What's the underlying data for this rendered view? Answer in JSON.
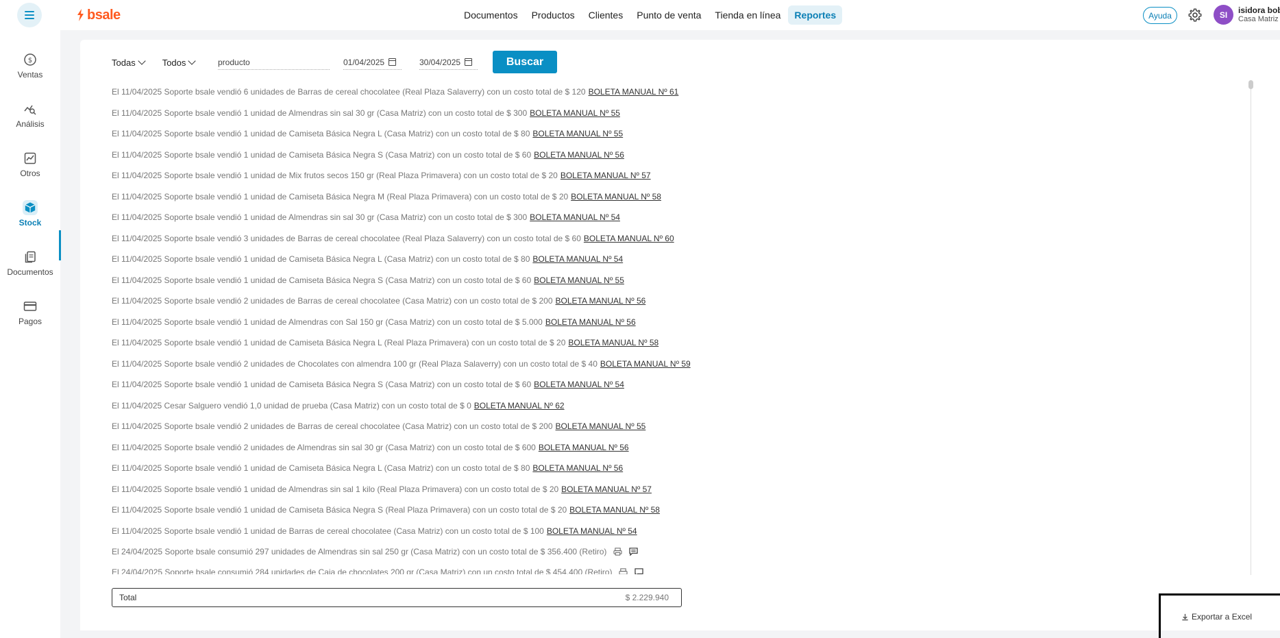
{
  "topbar": {
    "brand": "bsale",
    "nav": [
      "Documentos",
      "Productos",
      "Clientes",
      "Punto de venta",
      "Tienda en línea",
      "Reportes"
    ],
    "active_nav": "Reportes",
    "help_label": "Ayuda",
    "user_initials": "SI",
    "user_name": "isidora bob",
    "user_store": "Casa Matriz",
    "accent_color": "#0a8fc4",
    "brand_color": "#ff5a1f",
    "avatar_color": "#8e4ec6"
  },
  "sidebar": {
    "items": [
      {
        "label": "Ventas",
        "icon": "dollar-circle-icon"
      },
      {
        "label": "Análisis",
        "icon": "analytics-search-icon"
      },
      {
        "label": "Otros",
        "icon": "chart-trend-icon"
      },
      {
        "label": "Stock",
        "icon": "box-icon"
      },
      {
        "label": "Documentos",
        "icon": "documents-icon"
      },
      {
        "label": "Pagos",
        "icon": "credit-card-icon"
      }
    ],
    "active": "Stock"
  },
  "filters": {
    "filter1": "Todas",
    "filter2": "Todos",
    "search_value": "producto",
    "date_from": "01/04/2025",
    "date_to": "30/04/2025",
    "search_button": "Buscar"
  },
  "rows": [
    {
      "text": "El 11/04/2025 Soporte bsale vendió 6 unidades de Barras de cereal chocolatee (Real Plaza Salaverry) con un costo total de $ 120",
      "link": "BOLETA MANUAL Nº 61"
    },
    {
      "text": "El 11/04/2025 Soporte bsale vendió 1 unidad de Almendras sin sal 30 gr (Casa Matriz) con un costo total de $ 300",
      "link": "BOLETA MANUAL Nº 55"
    },
    {
      "text": "El 11/04/2025 Soporte bsale vendió 1 unidad de Camiseta Básica Negra L (Casa Matriz) con un costo total de $ 80",
      "link": "BOLETA MANUAL Nº 55"
    },
    {
      "text": "El 11/04/2025 Soporte bsale vendió 1 unidad de Camiseta Básica Negra S (Casa Matriz) con un costo total de $ 60",
      "link": "BOLETA MANUAL Nº 56"
    },
    {
      "text": "El 11/04/2025 Soporte bsale vendió 1 unidad de Mix frutos secos 150 gr (Real Plaza Primavera) con un costo total de $ 20",
      "link": "BOLETA MANUAL Nº 57"
    },
    {
      "text": "El 11/04/2025 Soporte bsale vendió 1 unidad de Camiseta Básica Negra M (Real Plaza Primavera) con un costo total de $ 20",
      "link": "BOLETA MANUAL Nº 58"
    },
    {
      "text": "El 11/04/2025 Soporte bsale vendió 1 unidad de Almendras sin sal 30 gr (Casa Matriz) con un costo total de $ 300",
      "link": "BOLETA MANUAL Nº 54"
    },
    {
      "text": "El 11/04/2025 Soporte bsale vendió 3 unidades de Barras de cereal chocolatee (Real Plaza Salaverry) con un costo total de $ 60",
      "link": "BOLETA MANUAL Nº 60"
    },
    {
      "text": "El 11/04/2025 Soporte bsale vendió 1 unidad de Camiseta Básica Negra L (Casa Matriz) con un costo total de $ 80",
      "link": "BOLETA MANUAL Nº 54"
    },
    {
      "text": "El 11/04/2025 Soporte bsale vendió 1 unidad de Camiseta Básica Negra S (Casa Matriz) con un costo total de $ 60",
      "link": "BOLETA MANUAL Nº 55"
    },
    {
      "text": "El 11/04/2025 Soporte bsale vendió 2 unidades de Barras de cereal chocolatee (Casa Matriz) con un costo total de $ 200",
      "link": "BOLETA MANUAL Nº 56"
    },
    {
      "text": "El 11/04/2025 Soporte bsale vendió 1 unidad de Almendras con Sal 150 gr (Casa Matriz) con un costo total de $ 5.000",
      "link": "BOLETA MANUAL Nº 56"
    },
    {
      "text": "El 11/04/2025 Soporte bsale vendió 1 unidad de Camiseta Básica Negra L (Real Plaza Primavera) con un costo total de $ 20",
      "link": "BOLETA MANUAL Nº 58"
    },
    {
      "text": "El 11/04/2025 Soporte bsale vendió 2 unidades de Chocolates con almendra 100 gr (Real Plaza Salaverry) con un costo total de $ 40",
      "link": "BOLETA MANUAL Nº 59"
    },
    {
      "text": "El 11/04/2025 Soporte bsale vendió 1 unidad de Camiseta Básica Negra S (Casa Matriz) con un costo total de $ 60",
      "link": "BOLETA MANUAL Nº 54"
    },
    {
      "text": "El 11/04/2025 Cesar Salguero vendió 1,0 unidad de prueba (Casa Matriz) con un costo total de $ 0",
      "link": "BOLETA MANUAL Nº 62"
    },
    {
      "text": "El 11/04/2025 Soporte bsale vendió 2 unidades de Barras de cereal chocolatee (Casa Matriz) con un costo total de $ 200",
      "link": "BOLETA MANUAL Nº 55"
    },
    {
      "text": "El 11/04/2025 Soporte bsale vendió 2 unidades de Almendras sin sal 30 gr (Casa Matriz) con un costo total de $ 600",
      "link": "BOLETA MANUAL Nº 56"
    },
    {
      "text": "El 11/04/2025 Soporte bsale vendió 1 unidad de Camiseta Básica Negra L (Casa Matriz) con un costo total de $ 80",
      "link": "BOLETA MANUAL Nº 56"
    },
    {
      "text": "El 11/04/2025 Soporte bsale vendió 1 unidad de Almendras sin sal 1 kilo (Real Plaza Primavera) con un costo total de $ 20",
      "link": "BOLETA MANUAL Nº 57"
    },
    {
      "text": "El 11/04/2025 Soporte bsale vendió 1 unidad de Camiseta Básica Negra S (Real Plaza Primavera) con un costo total de $ 20",
      "link": "BOLETA MANUAL Nº 58"
    },
    {
      "text": "El 11/04/2025 Soporte bsale vendió 1 unidad de Barras de cereal chocolatee (Casa Matriz) con un costo total de $ 100",
      "link": "BOLETA MANUAL Nº 54"
    },
    {
      "text": "El 24/04/2025 Soporte bsale consumió 297 unidades de Almendras sin sal 250 gr (Casa Matriz) con un costo total de $ 356.400 (Retiro)",
      "link": "",
      "icons": true
    },
    {
      "text": "El 24/04/2025 Soporte bsale consumió 284 unidades de Caja de chocolates 200 gr (Casa Matriz) con un costo total de $ 454.400 (Retiro)",
      "link": "",
      "icons": true
    }
  ],
  "total": {
    "label": "Total",
    "value": "$ 2.229.940"
  },
  "export_label": "Exportar a Excel"
}
